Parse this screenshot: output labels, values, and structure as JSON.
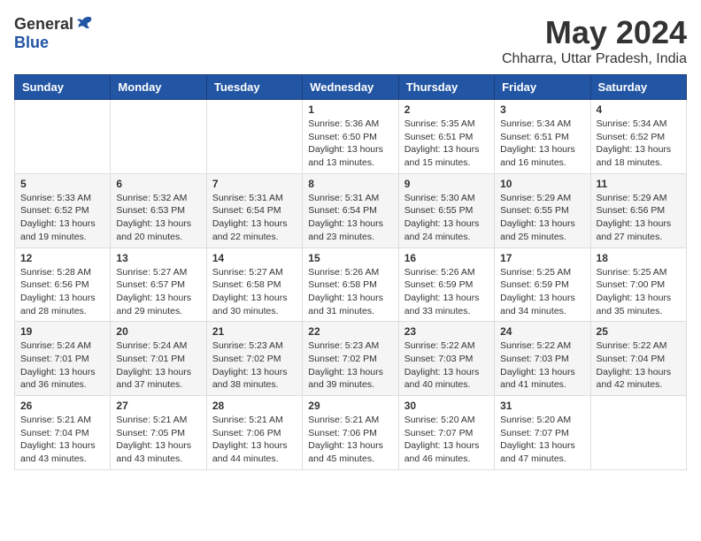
{
  "header": {
    "logo_general": "General",
    "logo_blue": "Blue",
    "month": "May 2024",
    "location": "Chharra, Uttar Pradesh, India"
  },
  "weekdays": [
    "Sunday",
    "Monday",
    "Tuesday",
    "Wednesday",
    "Thursday",
    "Friday",
    "Saturday"
  ],
  "weeks": [
    [
      {
        "day": "",
        "info": ""
      },
      {
        "day": "",
        "info": ""
      },
      {
        "day": "",
        "info": ""
      },
      {
        "day": "1",
        "info": "Sunrise: 5:36 AM\nSunset: 6:50 PM\nDaylight: 13 hours and 13 minutes."
      },
      {
        "day": "2",
        "info": "Sunrise: 5:35 AM\nSunset: 6:51 PM\nDaylight: 13 hours and 15 minutes."
      },
      {
        "day": "3",
        "info": "Sunrise: 5:34 AM\nSunset: 6:51 PM\nDaylight: 13 hours and 16 minutes."
      },
      {
        "day": "4",
        "info": "Sunrise: 5:34 AM\nSunset: 6:52 PM\nDaylight: 13 hours and 18 minutes."
      }
    ],
    [
      {
        "day": "5",
        "info": "Sunrise: 5:33 AM\nSunset: 6:52 PM\nDaylight: 13 hours and 19 minutes."
      },
      {
        "day": "6",
        "info": "Sunrise: 5:32 AM\nSunset: 6:53 PM\nDaylight: 13 hours and 20 minutes."
      },
      {
        "day": "7",
        "info": "Sunrise: 5:31 AM\nSunset: 6:54 PM\nDaylight: 13 hours and 22 minutes."
      },
      {
        "day": "8",
        "info": "Sunrise: 5:31 AM\nSunset: 6:54 PM\nDaylight: 13 hours and 23 minutes."
      },
      {
        "day": "9",
        "info": "Sunrise: 5:30 AM\nSunset: 6:55 PM\nDaylight: 13 hours and 24 minutes."
      },
      {
        "day": "10",
        "info": "Sunrise: 5:29 AM\nSunset: 6:55 PM\nDaylight: 13 hours and 25 minutes."
      },
      {
        "day": "11",
        "info": "Sunrise: 5:29 AM\nSunset: 6:56 PM\nDaylight: 13 hours and 27 minutes."
      }
    ],
    [
      {
        "day": "12",
        "info": "Sunrise: 5:28 AM\nSunset: 6:56 PM\nDaylight: 13 hours and 28 minutes."
      },
      {
        "day": "13",
        "info": "Sunrise: 5:27 AM\nSunset: 6:57 PM\nDaylight: 13 hours and 29 minutes."
      },
      {
        "day": "14",
        "info": "Sunrise: 5:27 AM\nSunset: 6:58 PM\nDaylight: 13 hours and 30 minutes."
      },
      {
        "day": "15",
        "info": "Sunrise: 5:26 AM\nSunset: 6:58 PM\nDaylight: 13 hours and 31 minutes."
      },
      {
        "day": "16",
        "info": "Sunrise: 5:26 AM\nSunset: 6:59 PM\nDaylight: 13 hours and 33 minutes."
      },
      {
        "day": "17",
        "info": "Sunrise: 5:25 AM\nSunset: 6:59 PM\nDaylight: 13 hours and 34 minutes."
      },
      {
        "day": "18",
        "info": "Sunrise: 5:25 AM\nSunset: 7:00 PM\nDaylight: 13 hours and 35 minutes."
      }
    ],
    [
      {
        "day": "19",
        "info": "Sunrise: 5:24 AM\nSunset: 7:01 PM\nDaylight: 13 hours and 36 minutes."
      },
      {
        "day": "20",
        "info": "Sunrise: 5:24 AM\nSunset: 7:01 PM\nDaylight: 13 hours and 37 minutes."
      },
      {
        "day": "21",
        "info": "Sunrise: 5:23 AM\nSunset: 7:02 PM\nDaylight: 13 hours and 38 minutes."
      },
      {
        "day": "22",
        "info": "Sunrise: 5:23 AM\nSunset: 7:02 PM\nDaylight: 13 hours and 39 minutes."
      },
      {
        "day": "23",
        "info": "Sunrise: 5:22 AM\nSunset: 7:03 PM\nDaylight: 13 hours and 40 minutes."
      },
      {
        "day": "24",
        "info": "Sunrise: 5:22 AM\nSunset: 7:03 PM\nDaylight: 13 hours and 41 minutes."
      },
      {
        "day": "25",
        "info": "Sunrise: 5:22 AM\nSunset: 7:04 PM\nDaylight: 13 hours and 42 minutes."
      }
    ],
    [
      {
        "day": "26",
        "info": "Sunrise: 5:21 AM\nSunset: 7:04 PM\nDaylight: 13 hours and 43 minutes."
      },
      {
        "day": "27",
        "info": "Sunrise: 5:21 AM\nSunset: 7:05 PM\nDaylight: 13 hours and 43 minutes."
      },
      {
        "day": "28",
        "info": "Sunrise: 5:21 AM\nSunset: 7:06 PM\nDaylight: 13 hours and 44 minutes."
      },
      {
        "day": "29",
        "info": "Sunrise: 5:21 AM\nSunset: 7:06 PM\nDaylight: 13 hours and 45 minutes."
      },
      {
        "day": "30",
        "info": "Sunrise: 5:20 AM\nSunset: 7:07 PM\nDaylight: 13 hours and 46 minutes."
      },
      {
        "day": "31",
        "info": "Sunrise: 5:20 AM\nSunset: 7:07 PM\nDaylight: 13 hours and 47 minutes."
      },
      {
        "day": "",
        "info": ""
      }
    ]
  ]
}
